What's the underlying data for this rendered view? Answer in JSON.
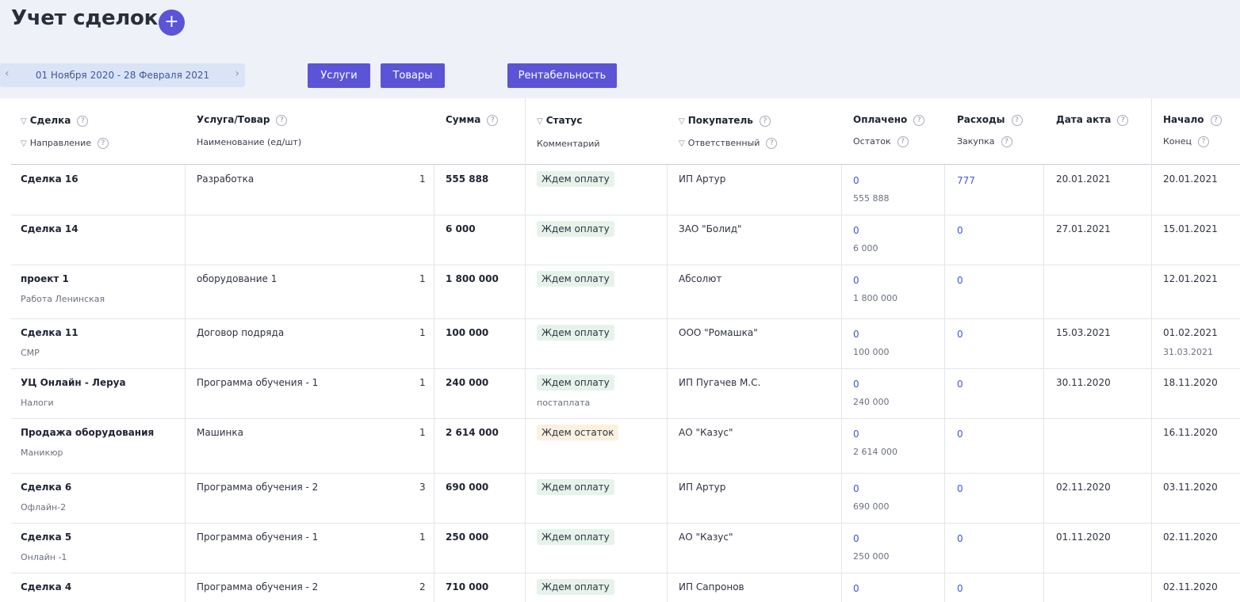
{
  "page": {
    "title": "Учет сделок",
    "add_icon": "+"
  },
  "filters": {
    "period": "01 Ноября 2020 - 28 Февраля 2021",
    "prev_icon": "‹",
    "next_icon": "›",
    "btn_services": "Услуги",
    "btn_goods": "Товары",
    "btn_profitability": "Рентабельность"
  },
  "headers": {
    "deal": "Сделка",
    "direction": "Направление",
    "item": "Услуга/Товар",
    "item_sub": "Наименование (ед/шт)",
    "sum": "Сумма",
    "status": "Статус",
    "comment": "Комментарий",
    "buyer": "Покупатель",
    "responsible": "Ответственный",
    "paid": "Оплачено",
    "rest": "Остаток",
    "expenses": "Расходы",
    "purchase": "Закупка",
    "act_date": "Дата акта",
    "start": "Начало",
    "end": "Конец",
    "help": "?",
    "filter_icon": "▽"
  },
  "rows": [
    {
      "deal": "Сделка 16",
      "direction": "",
      "item": "Разработка",
      "qty": "1",
      "sum": "555 888",
      "status": "Ждем оплату",
      "comment": "",
      "buyer": "ИП Артур",
      "paid": "0",
      "rest": "555 888",
      "expenses": "777",
      "act_date": "20.01.2021",
      "start": "20.01.2021",
      "end": ""
    },
    {
      "deal": "Сделка 14",
      "direction": "",
      "item": "",
      "qty": "",
      "sum": "6 000",
      "status": "Ждем оплату",
      "comment": "",
      "buyer": "ЗАО \"Болид\"",
      "paid": "0",
      "rest": "6 000",
      "expenses": "0",
      "act_date": "27.01.2021",
      "start": "15.01.2021",
      "end": ""
    },
    {
      "deal": "проект 1",
      "direction": "Работа Ленинская",
      "item": "оборудование 1",
      "qty": "1",
      "sum": "1 800 000",
      "status": "Ждем оплату",
      "comment": "",
      "buyer": "Абсолют",
      "paid": "0",
      "rest": "1 800 000",
      "expenses": "0",
      "act_date": "",
      "start": "12.01.2021",
      "end": ""
    },
    {
      "deal": "Сделка 11",
      "direction": "СМР",
      "item": "Договор подряда",
      "qty": "1",
      "sum": "100 000",
      "status": "Ждем оплату",
      "comment": "",
      "buyer": "ООО \"Ромашка\"",
      "paid": "0",
      "rest": "100 000",
      "expenses": "0",
      "act_date": "15.03.2021",
      "start": "01.02.2021",
      "end": "31.03.2021"
    },
    {
      "deal": "УЦ Онлайн - Леруа",
      "direction": "Налоги",
      "item": "Программа обучения - 1",
      "qty": "1",
      "sum": "240 000",
      "status": "Ждем оплату",
      "comment": "постаплата",
      "buyer": "ИП Пугачев М.С.",
      "paid": "0",
      "rest": "240 000",
      "expenses": "0",
      "act_date": "30.11.2020",
      "start": "18.11.2020",
      "end": ""
    },
    {
      "deal": "Продажа оборудования",
      "direction": "Маникюр",
      "item": "Машинка",
      "qty": "1",
      "sum": "2 614 000",
      "status": "Ждем остаток",
      "comment": "",
      "buyer": "АО \"Казус\"",
      "paid": "0",
      "rest": "2 614 000",
      "expenses": "0",
      "act_date": "",
      "start": "16.11.2020",
      "end": ""
    },
    {
      "deal": "Сделка 6",
      "direction": "Офлайн-2",
      "item": "Программа обучения - 2",
      "qty": "3",
      "sum": "690 000",
      "status": "Ждем оплату",
      "comment": "",
      "buyer": "ИП Артур",
      "paid": "0",
      "rest": "690 000",
      "expenses": "0",
      "act_date": "02.11.2020",
      "start": "03.11.2020",
      "end": ""
    },
    {
      "deal": "Сделка 5",
      "direction": "Онлайн -1",
      "item": "Программа обучения - 1",
      "qty": "1",
      "sum": "250 000",
      "status": "Ждем оплату",
      "comment": "",
      "buyer": "АО \"Казус\"",
      "paid": "0",
      "rest": "250 000",
      "expenses": "0",
      "act_date": "01.11.2020",
      "start": "02.11.2020",
      "end": ""
    },
    {
      "deal": "Сделка 4",
      "direction": "",
      "item": "Программа обучения - 2",
      "qty": "2",
      "sum": "710 000",
      "status": "Ждем оплату",
      "comment": "",
      "buyer": "ИП Сапронов",
      "paid": "0",
      "rest": "",
      "expenses": "0",
      "act_date": "",
      "start": "02.11.2020",
      "end": ""
    }
  ]
}
